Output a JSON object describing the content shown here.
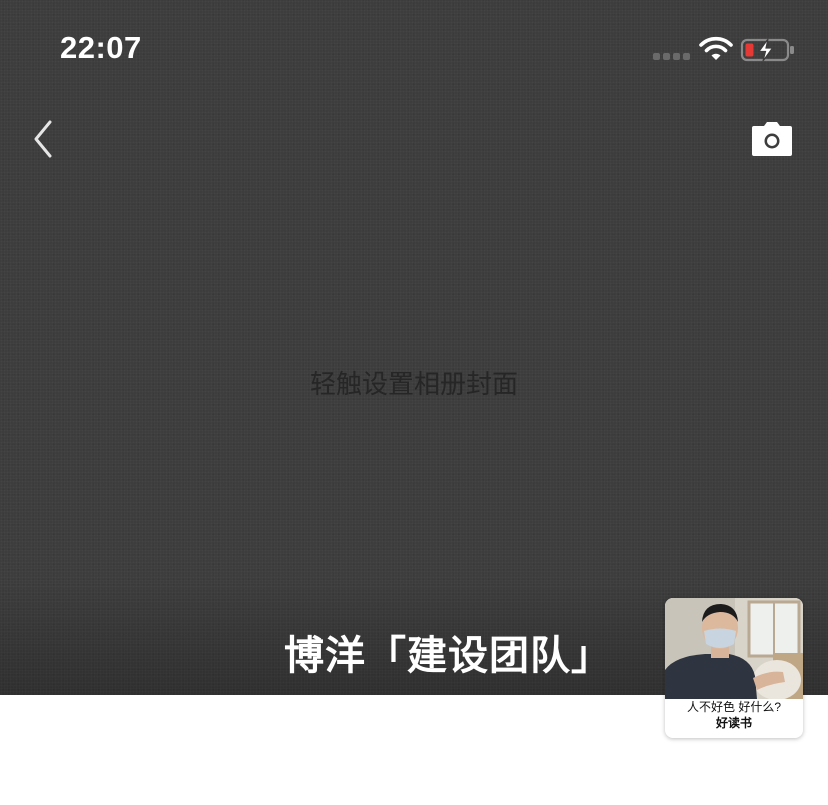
{
  "status_bar": {
    "time": "22:07",
    "battery_state": "low-charging",
    "battery_color": "#e53935"
  },
  "nav": {
    "back_icon": "chevron-left-icon",
    "camera_icon": "camera-icon"
  },
  "cover": {
    "hint": "轻触设置相册封面",
    "background_color": "#3d3d3d"
  },
  "album": {
    "title": "博洋「建设团队」"
  },
  "floating_card": {
    "caption": "人不好色 好什么?",
    "brand": "好读书"
  }
}
